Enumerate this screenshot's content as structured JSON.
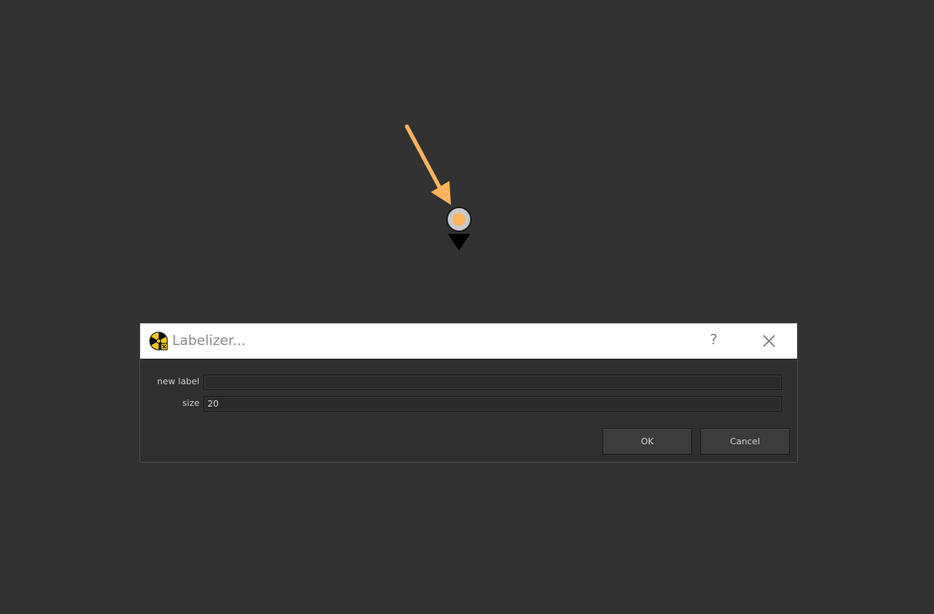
{
  "dialog": {
    "title": "Labelizer...",
    "help_glyph": "?",
    "fields": [
      {
        "label": "new label",
        "value": ""
      },
      {
        "label": "size",
        "value": "20"
      }
    ],
    "ok_label": "OK",
    "cancel_label": "Cancel"
  },
  "icons": {
    "app": "nuke-app-icon",
    "help": "help-icon",
    "close": "close-icon",
    "pointer": "arrow-pointer-icon",
    "node": "dot-node-icon"
  },
  "colors": {
    "background": "#323232",
    "accent_orange": "#fcb45c",
    "node_fill": "#c8c8c8",
    "titlebar": "#ffffff"
  }
}
